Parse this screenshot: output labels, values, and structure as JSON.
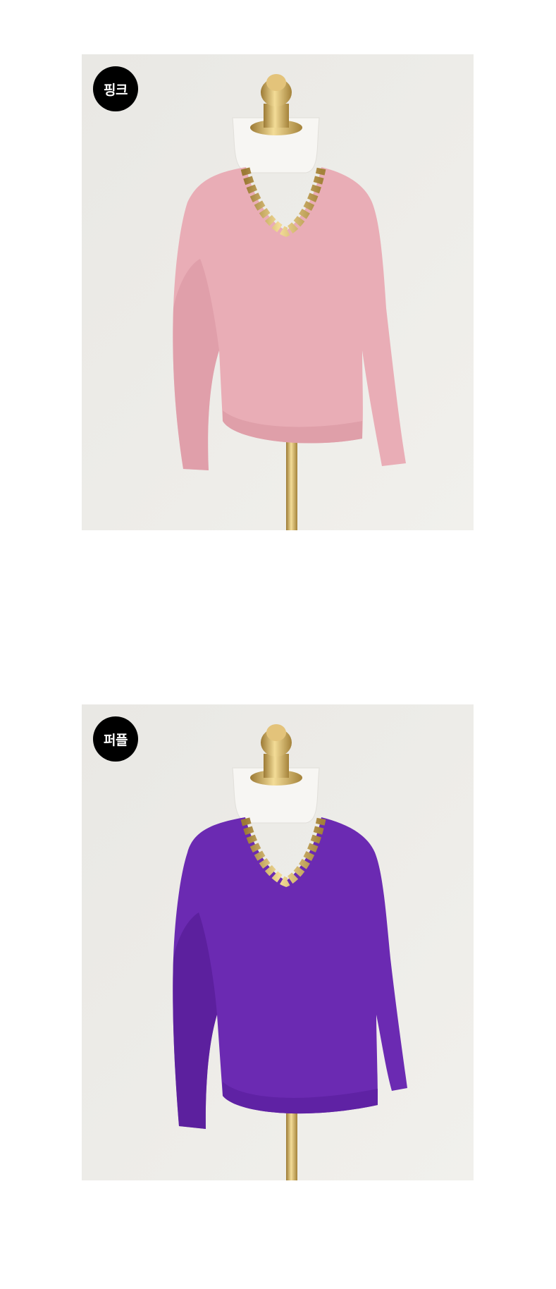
{
  "products": [
    {
      "color_label": "핑크",
      "sweater_color": "#e9adb6",
      "sweater_shade": "#d894a0",
      "sweater_rib": "#df9fa9"
    },
    {
      "color_label": "퍼플",
      "sweater_color": "#6b2ab2",
      "sweater_shade": "#561d96",
      "sweater_rib": "#5f22a4"
    }
  ],
  "colors": {
    "background": "#ffffff",
    "photo_backdrop": "#ecebe7",
    "badge": "#000000",
    "badge_text": "#ffffff",
    "gold": "#d8b063",
    "mannequin": "#f7f6f3"
  }
}
